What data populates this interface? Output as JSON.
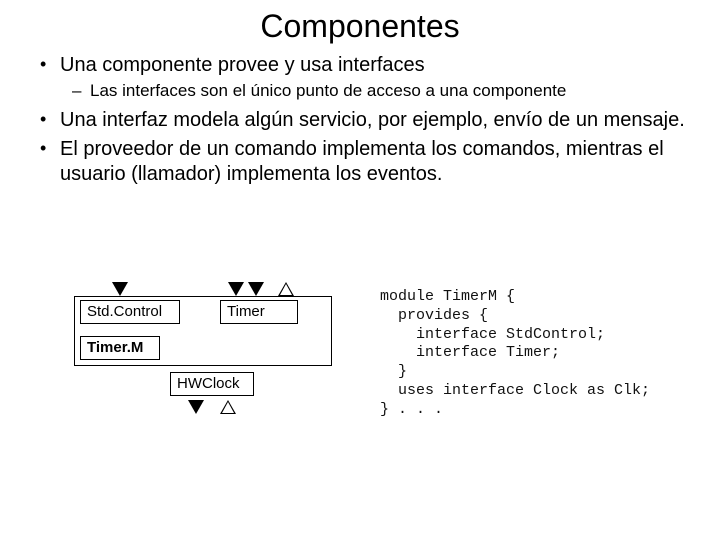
{
  "title": "Componentes",
  "bullets": {
    "b1": "Una componente provee y usa interfaces",
    "b1a": "Las interfaces son el único punto de acceso a una componente",
    "b2": "Una interfaz modela algún servicio, por ejemplo, envío de un mensaje.",
    "b3": "El proveedor de un comando implementa los comandos, mientras el usuario (llamador) implementa los eventos."
  },
  "diagram": {
    "stdcontrol": "Std.Control",
    "timer": "Timer",
    "timerm": "Timer.M",
    "hwclock": "HWClock"
  },
  "code": "module TimerM {\n  provides {\n    interface StdControl;\n    interface Timer;\n  }\n  uses interface Clock as Clk;\n} . . ."
}
